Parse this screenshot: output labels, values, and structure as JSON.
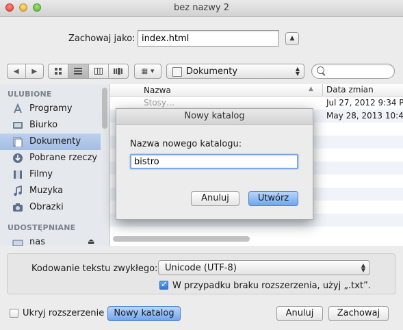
{
  "window": {
    "title": "bez nazwy 2"
  },
  "save": {
    "label": "Zachowaj jako:",
    "filename": "index.html"
  },
  "toolbar": {
    "nav_back": "◀",
    "nav_forward": "▶",
    "arrange_icon": "▦",
    "arrange_arrow": "▼",
    "location": "Dokumenty",
    "search_placeholder": ""
  },
  "sidebar": {
    "favorites_header": "ULUBIONE",
    "favorites": [
      {
        "label": "Programy",
        "icon": "applications-icon",
        "color": "#7a8ba3"
      },
      {
        "label": "Biurko",
        "icon": "desktop-icon",
        "color": "#5f6f85"
      },
      {
        "label": "Dokumenty",
        "icon": "documents-icon",
        "color": "#6d7f99"
      },
      {
        "label": "Pobrane rzeczy",
        "icon": "downloads-icon",
        "color": "#5a6b82"
      },
      {
        "label": "Filmy",
        "icon": "movies-icon",
        "color": "#5a6b82"
      },
      {
        "label": "Muzyka",
        "icon": "music-icon",
        "color": "#5a6b82"
      },
      {
        "label": "Obrazki",
        "icon": "pictures-icon",
        "color": "#5a6b82"
      }
    ],
    "shared_header": "UDOSTĘPNIANE",
    "shared": [
      {
        "label": "nas",
        "icon": "server-icon"
      }
    ]
  },
  "list": {
    "col_name": "Nazwa",
    "col_date": "Data zmian",
    "rows": [
      {
        "name": "Stosy…",
        "date": "Jul 27, 2012 9:34 P"
      },
      {
        "name": "",
        "date": "May 28, 2013 10:4"
      }
    ]
  },
  "encoding": {
    "label": "Kodowanie tekstu zwykłego:",
    "value": "Unicode (UTF-8)",
    "ext_checkbox_label": "W przypadku braku rozszerzenia, użyj „.txt”.",
    "ext_checked": true
  },
  "footer": {
    "hide_ext_label": "Ukryj rozszerzenie",
    "hide_ext_checked": false,
    "new_folder": "Nowy katalog",
    "cancel": "Anuluj",
    "save": "Zachowaj"
  },
  "dialog": {
    "title": "Nowy katalog",
    "prompt": "Nazwa nowego katalogu:",
    "value": "bistro",
    "cancel": "Anuluj",
    "create": "Utwórz"
  }
}
